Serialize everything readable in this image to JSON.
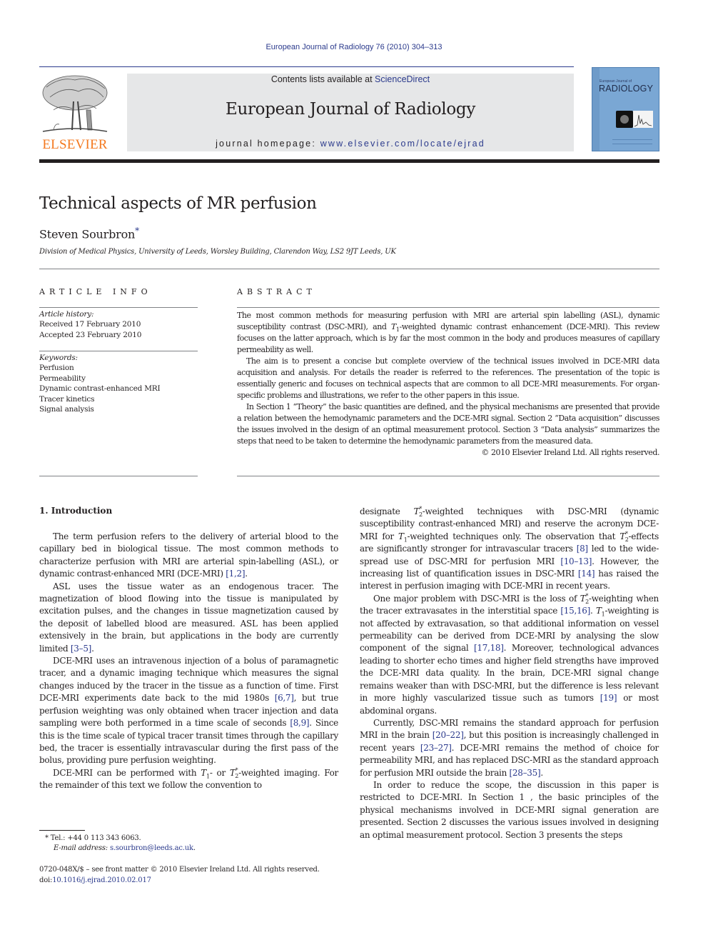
{
  "header": {
    "journal_reference": "European Journal of Radiology 76 (2010) 304–313",
    "publisher_logo_text": "ELSEVIER",
    "contents_prefix": "Contents lists available at ",
    "contents_link": "ScienceDirect",
    "journal_title": "European Journal of Radiology",
    "homepage_prefix": "journal homepage: ",
    "homepage_url": "www.elsevier.com/locate/ejrad",
    "cover_small_text": "European Journal of",
    "cover_title": "RADIOLOGY"
  },
  "article": {
    "title": "Technical aspects of MR perfusion",
    "author": "Steven Sourbron",
    "author_mark": "*",
    "affiliation": "Division of Medical Physics, University of Leeds, Worsley Building, Clarendon Way, LS2 9JT Leeds, UK"
  },
  "article_info": {
    "heading": "ARTICLE INFO",
    "history_label": "Article history:",
    "received": "Received 17 February 2010",
    "accepted": "Accepted 23 February 2010",
    "keywords_label": "Keywords:",
    "keywords": [
      "Perfusion",
      "Permeability",
      "Dynamic contrast-enhanced MRI",
      "Tracer kinetics",
      "Signal analysis"
    ]
  },
  "abstract": {
    "heading": "ABSTRACT",
    "p1_a": "The most common methods for measuring perfusion with MRI are arterial spin labelling (ASL), dynamic susceptibility contrast (DSC-MRI), and ",
    "p1_b": "-weighted dynamic contrast enhancement (DCE-MRI). This review focuses on the latter approach, which is by far the most common in the body and produces measures of capillary permeability as well.",
    "p2": "The aim is to present a concise but complete overview of the technical issues involved in DCE-MRI data acquisition and analysis. For details the reader is referred to the references. The presentation of the topic is essentially generic and focuses on technical aspects that are common to all DCE-MRI measurements. For organ-specific problems and illustrations, we refer to the other papers in this issue.",
    "p3": "In Section 1 “Theory” the basic quantities are defined, and the physical mechanisms are presented that provide a relation between the hemodynamic parameters and the DCE-MRI signal. Section 2 “Data acquisition” discusses the issues involved in the design of an optimal measurement protocol. Section 3 “Data analysis” summarizes the steps that need to be taken to determine the hemodynamic parameters from the measured data.",
    "copyright": "© 2010 Elsevier Ireland Ltd. All rights reserved."
  },
  "symbols": {
    "T": "T",
    "sub1": "1",
    "sub2": "2",
    "star": "*"
  },
  "body": {
    "section_heading": "1.  Introduction",
    "left": {
      "p1_a": "The term perfusion refers to the delivery of arterial blood to the capillary bed in biological tissue. The most common methods to characterize perfusion with MRI are arterial spin-labelling (ASL), or dynamic contrast-enhanced MRI (DCE-MRI) ",
      "p1_ref": "[1,2]",
      "p2_a": "ASL uses the tissue water as an endogenous tracer. The magnetization of blood flowing into the tissue is manipulated by excitation pulses, and the changes in tissue magnetization caused by the deposit of labelled blood are measured. ASL has been applied extensively in the brain, but applications in the body are currently limited ",
      "p2_ref": "[3–5]",
      "p3_a": "DCE-MRI uses an intravenous injection of a bolus of paramagnetic tracer, and a dynamic imaging technique which measures the signal changes induced by the tracer in the tissue as a function of time. First DCE-MRI experiments date back to the mid 1980s ",
      "p3_ref1": "[6,7]",
      "p3_b": ", but true perfusion weighting was only obtained when tracer injection and data sampling were both performed in a time scale of seconds ",
      "p3_ref2": "[8,9]",
      "p3_c": ". Since this is the time scale of typical tracer transit times through the capillary bed, the tracer is essentially intravascular during the first pass of the bolus, providing pure perfusion weighting.",
      "p4_a": "DCE-MRI can be performed with ",
      "p4_b": "- or ",
      "p4_c": "-weighted imaging. For the remainder of this text we follow the convention to"
    },
    "right": {
      "p1_a": "designate ",
      "p1_b": "-weighted techniques with DSC-MRI (dynamic susceptibility contrast-enhanced MRI) and reserve the acronym DCE-MRI for ",
      "p1_c": "-weighted techniques only. The observation that ",
      "p1_d": "-effects are significantly stronger for intravascular tracers ",
      "p1_ref1": "[8]",
      "p1_e": " led to the wide-spread use of DSC-MRI for perfusion MRI ",
      "p1_ref2": "[10–13]",
      "p1_f": ". However, the increasing list of quantification issues in DSC-MRI ",
      "p1_ref3": "[14]",
      "p1_g": " has raised the interest in perfusion imaging with DCE-MRI in recent years.",
      "p2_a": "One major problem with DSC-MRI is the loss of ",
      "p2_b": "-weighting when the tracer extravasates in the interstitial space ",
      "p2_ref1": "[15,16]",
      "p2_c": ". ",
      "p2_d": "-weighting is not affected by extravasation, so that additional information on vessel permeability can be derived from DCE-MRI by analysing the slow component of the signal ",
      "p2_ref2": "[17,18]",
      "p2_e": ". Moreover, technological advances leading to shorter echo times and higher field strengths have improved the DCE-MRI data quality. In the brain, DCE-MRI signal change remains weaker than with DSC-MRI, but the difference is less relevant in more highly vascularized tissue such as tumors ",
      "p2_ref3": "[19]",
      "p2_f": " or most abdominal organs.",
      "p3_a": "Currently, DSC-MRI remains the standard approach for perfusion MRI in the brain ",
      "p3_ref1": "[20–22]",
      "p3_b": ", but this position is increasingly challenged in recent years ",
      "p3_ref2": "[23–27]",
      "p3_c": ". DCE-MRI remains the method of choice for permeability MRI, and has replaced DSC-MRI as the standard approach for perfusion MRI outside the brain ",
      "p3_ref3": "[28–35]",
      "p4": "In order to reduce the scope, the discussion in this paper is restricted to DCE-MRI. In Section 1 , the basic principles of the physical mechanisms involved in DCE-MRI signal generation are presented. Section 2 discusses the various issues involved in designing an optimal measurement protocol. Section 3 presents the steps"
    }
  },
  "footnotes": {
    "tel": "* Tel.: +44 0 113 343 6063.",
    "email_label": "E-mail address: ",
    "email": "s.sourbron@leeds.ac.uk",
    "front_matter": "0720-048X/$ – see front matter © 2010 Elsevier Ireland Ltd. All rights reserved.",
    "doi_prefix": "doi:",
    "doi": "10.1016/j.ejrad.2010.02.017"
  },
  "punct": {
    "period": "."
  },
  "colors": {
    "link": "#2b3a8c",
    "elsevier_orange": "#f47920",
    "banner_bg": "#e6e7e8",
    "cover_blue": "#7aa7d4"
  }
}
